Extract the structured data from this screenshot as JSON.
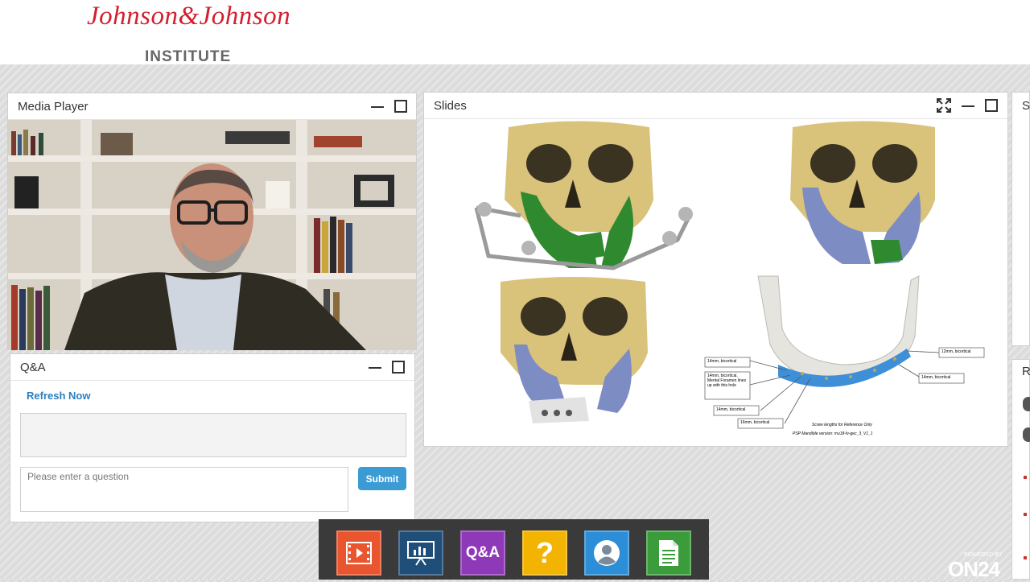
{
  "header": {
    "logo_script": "Johnson&Johnson",
    "logo_sub": "INSTITUTE"
  },
  "media_player": {
    "title": "Media Player"
  },
  "slides": {
    "title": "Slides",
    "annotations": {
      "left_labels": [
        "14mm, bicortical",
        "14mm, bicortical, Mental Foramen lines up with this hole",
        "14mm, bicortical",
        "16mm, bicortical"
      ],
      "right_labels": [
        "12mm, bicortical",
        "14mm, bicortical"
      ],
      "footer_line1": "Screw lengths for Reference Only",
      "footer_line2": "PSP Mandible version: mu18-fv-gec_3_V1_1"
    }
  },
  "qa": {
    "title": "Q&A",
    "refresh_label": "Refresh Now",
    "input_placeholder": "Please enter a question",
    "submit_label": "Submit"
  },
  "dock": {
    "items": [
      {
        "name": "media-player",
        "icon": "film-icon",
        "color": "#e8552f"
      },
      {
        "name": "slides",
        "icon": "presentation-icon",
        "color": "#1f4e79"
      },
      {
        "name": "qa",
        "icon": "qa-text-icon",
        "label": "Q&A",
        "color": "#8e3ab8"
      },
      {
        "name": "help",
        "icon": "question-icon",
        "label": "?",
        "color": "#f2b400"
      },
      {
        "name": "speaker-bio",
        "icon": "person-icon",
        "color": "#2b8ed6"
      },
      {
        "name": "resources",
        "icon": "document-icon",
        "color": "#3b9c3b"
      }
    ]
  },
  "edge_panels": {
    "top_letter": "S",
    "bottom_letter": "R"
  },
  "branding": {
    "powered_by": "POWERED BY",
    "on24": "ON24"
  },
  "colors": {
    "logo_red": "#d2202f",
    "link_blue": "#2b7fc0",
    "submit_blue": "#3a9bd5"
  }
}
